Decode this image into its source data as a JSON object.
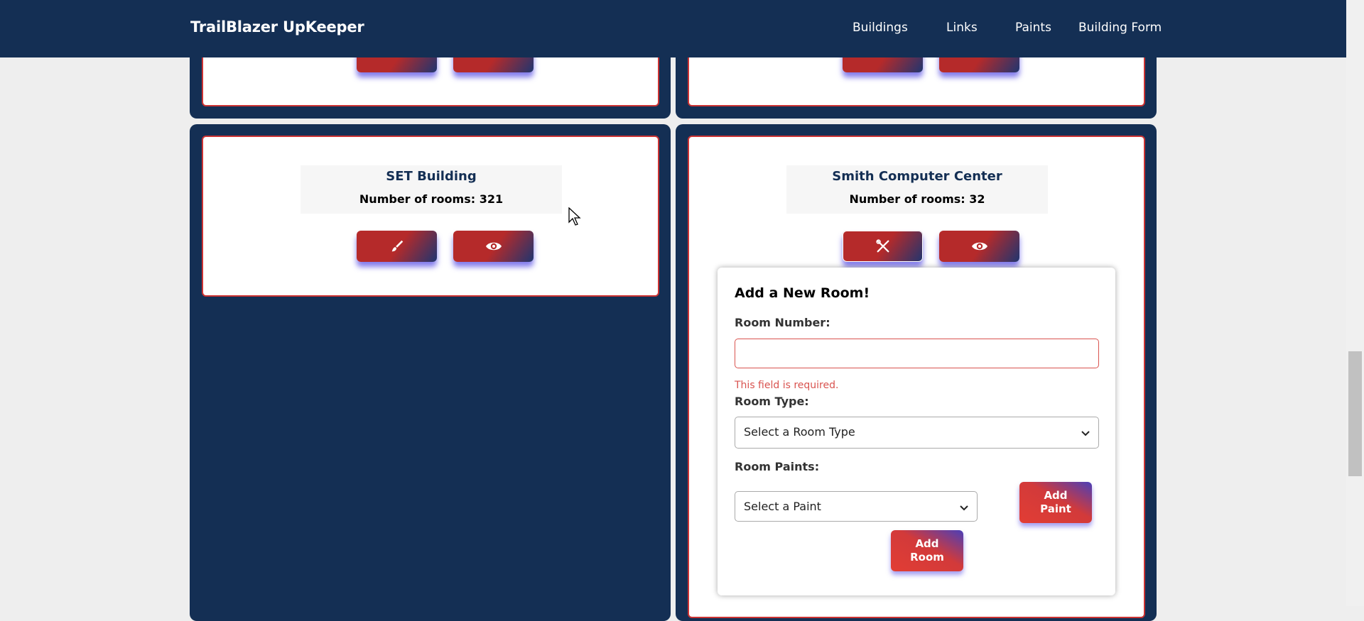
{
  "app": {
    "title": "TrailBlazer UpKeeper"
  },
  "nav": [
    {
      "label": "Buildings"
    },
    {
      "label": "Links"
    },
    {
      "label": "Paints"
    },
    {
      "label": "Building Form"
    }
  ],
  "buildings": [
    {
      "name": "SET Building",
      "rooms_text": "Number of rooms: 321"
    },
    {
      "name": "Smith Computer Center",
      "rooms_text": "Number of rooms: 32"
    }
  ],
  "icons": {
    "edit": "paintbrush-icon",
    "close_edit": "crossed-tools-icon",
    "view": "eye-icon"
  },
  "form": {
    "title": "Add a New Room!",
    "room_number_label": "Room Number:",
    "room_number_value": "",
    "error_text": "This field is required.",
    "room_type_label": "Room Type:",
    "room_type_selected": "Select a Room Type",
    "room_paints_label": "Room Paints:",
    "paint_selected": "Select a Paint",
    "add_paint_line1": "Add",
    "add_paint_line2": "Paint",
    "add_room_line1": "Add",
    "add_room_line2": "Room"
  },
  "colors": {
    "navy": "#142f54",
    "accent_red": "#cc3333",
    "error": "#d9534f"
  }
}
